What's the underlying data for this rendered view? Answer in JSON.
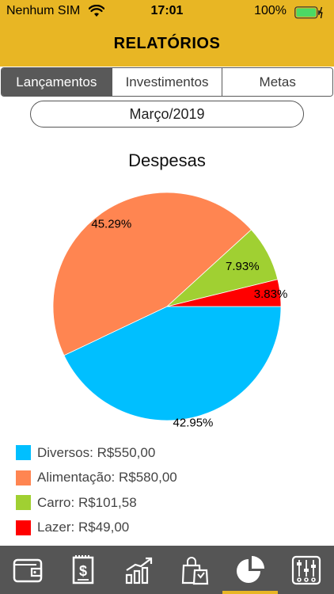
{
  "status": {
    "carrier": "Nenhum SIM",
    "time": "17:01",
    "battery": "100%"
  },
  "header": {
    "title": "RELATÓRIOS"
  },
  "segments": [
    {
      "label": "Lançamentos",
      "active": true
    },
    {
      "label": "Investimentos",
      "active": false
    },
    {
      "label": "Metas",
      "active": false
    }
  ],
  "month": "Março/2019",
  "chart_data": {
    "type": "pie",
    "title": "Despesas",
    "slices": [
      {
        "name": "Diversos",
        "value": 550.0,
        "percent_label": "42.95%",
        "color": "#00bfff"
      },
      {
        "name": "Alimentação",
        "value": 580.0,
        "percent_label": "45.29%",
        "color": "#ff8551"
      },
      {
        "name": "Carro",
        "value": 101.58,
        "percent_label": "7.93%",
        "color": "#a0d032"
      },
      {
        "name": "Lazer",
        "value": 49.0,
        "percent_label": "3.83%",
        "color": "#ff0000"
      }
    ]
  },
  "legend": [
    {
      "label": "Diversos: R$550,00",
      "color": "#00bfff"
    },
    {
      "label": "Alimentação: R$580,00",
      "color": "#ff8551"
    },
    {
      "label": "Carro: R$101,58",
      "color": "#a0d032"
    },
    {
      "label": "Lazer: R$49,00",
      "color": "#ff0000"
    }
  ],
  "tabbar": {
    "active": 4,
    "items": [
      {
        "icon": "wallet-icon"
      },
      {
        "icon": "bill-icon"
      },
      {
        "icon": "growth-chart-icon"
      },
      {
        "icon": "shopping-bag-icon"
      },
      {
        "icon": "pie-chart-icon"
      },
      {
        "icon": "sliders-icon"
      }
    ]
  },
  "colors": {
    "accent": "#e8b624",
    "tabbar": "#555555"
  }
}
